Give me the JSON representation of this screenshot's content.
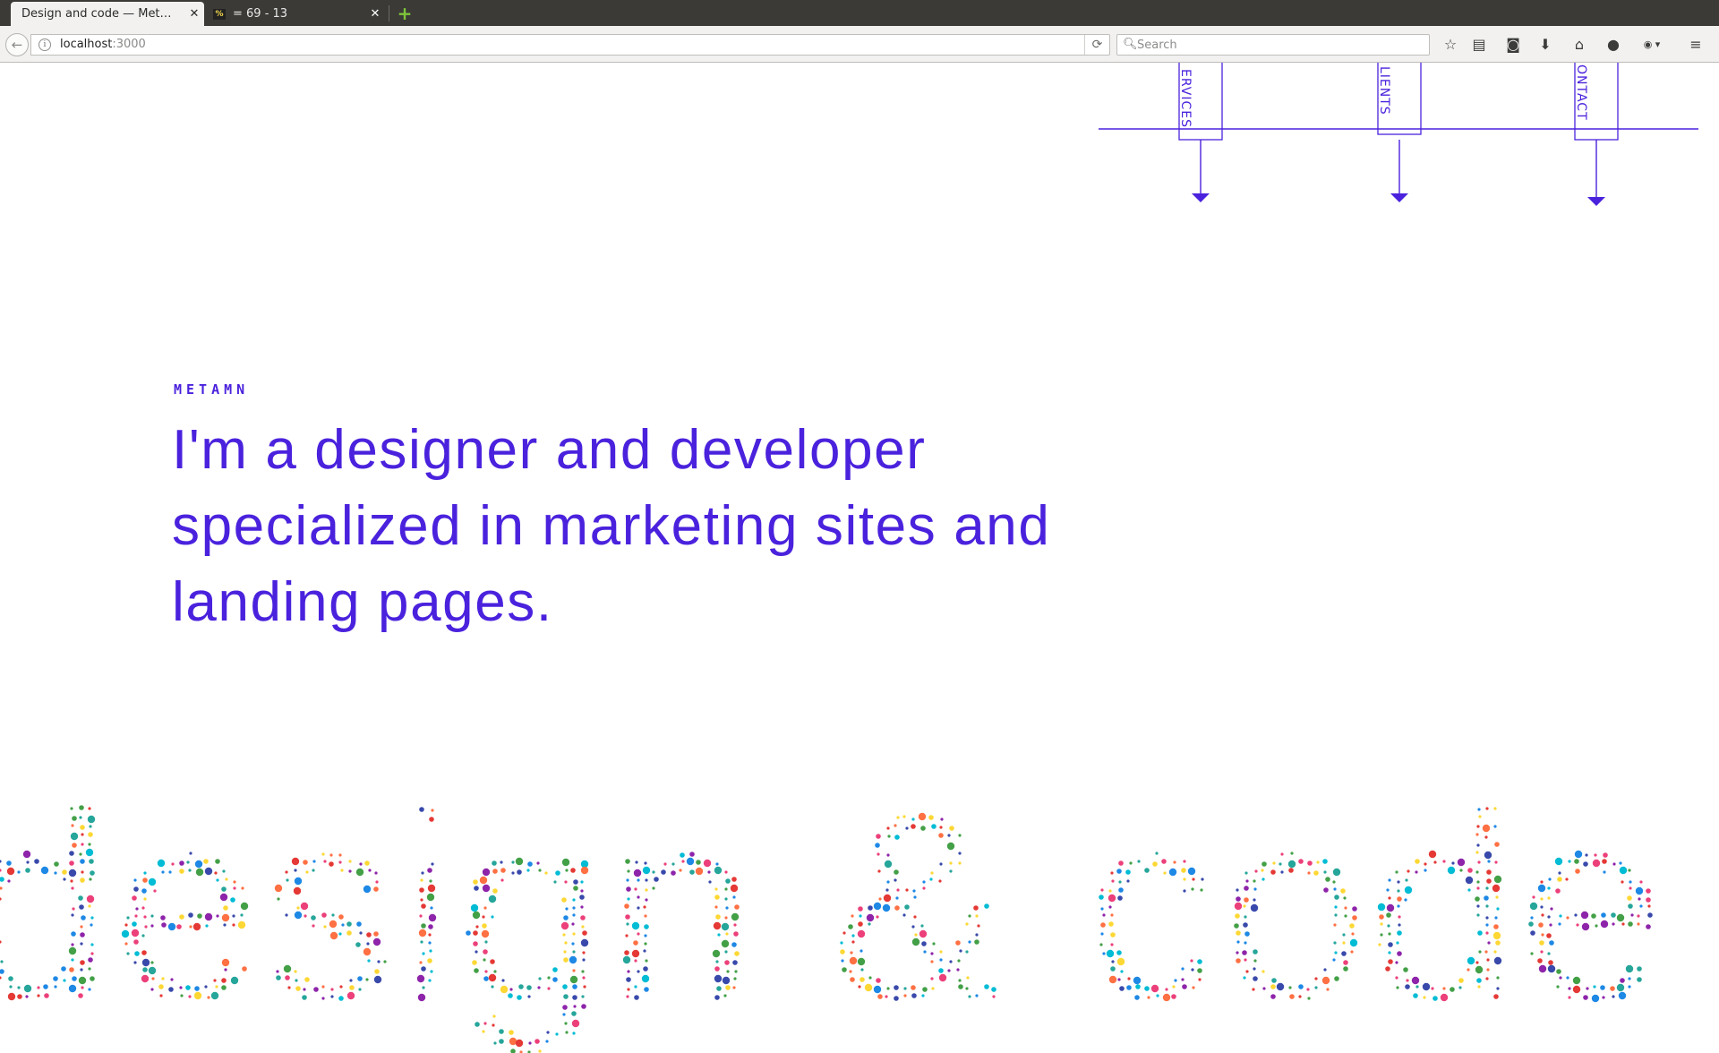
{
  "browser": {
    "tabs": [
      {
        "title": "Design and code — Met…",
        "active": true
      },
      {
        "title": "= 69 - 13",
        "favicon": "%",
        "active": false
      }
    ],
    "url": {
      "host": "localhost",
      "port": ":3000"
    },
    "search_placeholder": "Search",
    "toolbar_icons": [
      "bookmark-star-icon",
      "reading-list-icon",
      "pocket-icon",
      "download-icon",
      "home-icon",
      "chat-icon",
      "adblock-icon",
      "menu-icon"
    ]
  },
  "nav": {
    "items": [
      {
        "label": "SERVICES",
        "visible_text": "ERVICES"
      },
      {
        "label": "CLIENTS",
        "visible_text": "LIENTS"
      },
      {
        "label": "CONTACT",
        "visible_text": "ONTACT"
      }
    ]
  },
  "hero": {
    "brand": "METAMN",
    "headline_lines": [
      "I'm a designer and developer",
      "specialized in marketing sites and",
      "landing pages."
    ]
  },
  "dotted_tagline": "design & code",
  "colors": {
    "accent": "#4a22dd",
    "dot_palette": [
      "#e53935",
      "#fdd835",
      "#1e88e5",
      "#43a047",
      "#8e24aa",
      "#00bcd4",
      "#ff7043",
      "#3949ab",
      "#26a69a",
      "#ec407a"
    ]
  }
}
